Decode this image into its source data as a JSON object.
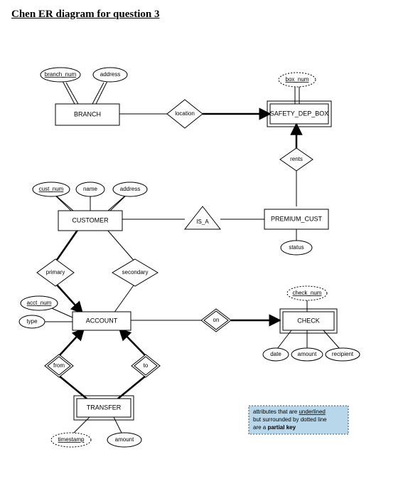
{
  "title": "Chen ER diagram for question 3",
  "entities": {
    "branch": "BRANCH",
    "safety_dep_box": "SAFETY_DEP_BOX",
    "customer": "CUSTOMER",
    "premium_cust": "PREMIUM_CUST",
    "account": "ACCOUNT",
    "check": "CHECK",
    "transfer": "TRANSFER"
  },
  "relationships": {
    "location": "location",
    "rents": "rents",
    "is_a": "IS_A",
    "primary": "primary",
    "secondary": "secondary",
    "on": "on",
    "from": "from",
    "to": "to"
  },
  "attributes": {
    "branch_num": "branch_num",
    "address": "address",
    "box_num": "box_num",
    "cust_num": "cust_num",
    "name": "name",
    "status": "status",
    "acct_num": "acct_num",
    "type": "type",
    "check_num": "check_num",
    "date": "date",
    "amount": "amount",
    "recipient": "recipient",
    "timestamp": "timestamp"
  },
  "note": {
    "line1a": "attributes that are ",
    "line1b": "underlined",
    "line2": "but surrounded by dotted line",
    "line3a": "are a ",
    "line3b": "partial key"
  },
  "chart_data": {
    "type": "er-diagram",
    "notation": "Chen",
    "entities": [
      {
        "name": "BRANCH",
        "weak": false,
        "attributes": [
          {
            "name": "branch_num",
            "key": "primary"
          },
          {
            "name": "address"
          }
        ]
      },
      {
        "name": "SAFETY_DEP_BOX",
        "weak": true,
        "attributes": [
          {
            "name": "box_num",
            "key": "partial"
          }
        ]
      },
      {
        "name": "CUSTOMER",
        "weak": false,
        "attributes": [
          {
            "name": "cust_num",
            "key": "primary"
          },
          {
            "name": "name"
          },
          {
            "name": "address"
          }
        ]
      },
      {
        "name": "PREMIUM_CUST",
        "weak": false,
        "attributes": [
          {
            "name": "status"
          }
        ]
      },
      {
        "name": "ACCOUNT",
        "weak": false,
        "attributes": [
          {
            "name": "acct_num",
            "key": "primary"
          },
          {
            "name": "type"
          }
        ]
      },
      {
        "name": "CHECK",
        "weak": true,
        "attributes": [
          {
            "name": "check_num",
            "key": "partial"
          },
          {
            "name": "date"
          },
          {
            "name": "amount"
          },
          {
            "name": "recipient"
          }
        ]
      },
      {
        "name": "TRANSFER",
        "weak": true,
        "attributes": [
          {
            "name": "timestamp",
            "key": "partial"
          },
          {
            "name": "amount"
          }
        ]
      }
    ],
    "relationships": [
      {
        "name": "location",
        "between": [
          "BRANCH",
          "SAFETY_DEP_BOX"
        ],
        "identifying_for": "SAFETY_DEP_BOX"
      },
      {
        "name": "rents",
        "between": [
          "SAFETY_DEP_BOX",
          "PREMIUM_CUST"
        ]
      },
      {
        "name": "IS_A",
        "supertype": "CUSTOMER",
        "subtype": "PREMIUM_CUST"
      },
      {
        "name": "primary",
        "between": [
          "CUSTOMER",
          "ACCOUNT"
        ],
        "total_on": "CUSTOMER"
      },
      {
        "name": "secondary",
        "between": [
          "CUSTOMER",
          "ACCOUNT"
        ]
      },
      {
        "name": "on",
        "between": [
          "ACCOUNT",
          "CHECK"
        ],
        "identifying_for": "CHECK"
      },
      {
        "name": "from",
        "between": [
          "ACCOUNT",
          "TRANSFER"
        ],
        "identifying_for": "TRANSFER"
      },
      {
        "name": "to",
        "between": [
          "ACCOUNT",
          "TRANSFER"
        ],
        "identifying_for": "TRANSFER"
      }
    ],
    "legend": "attributes that are underlined but surrounded by dotted line are a partial key"
  }
}
